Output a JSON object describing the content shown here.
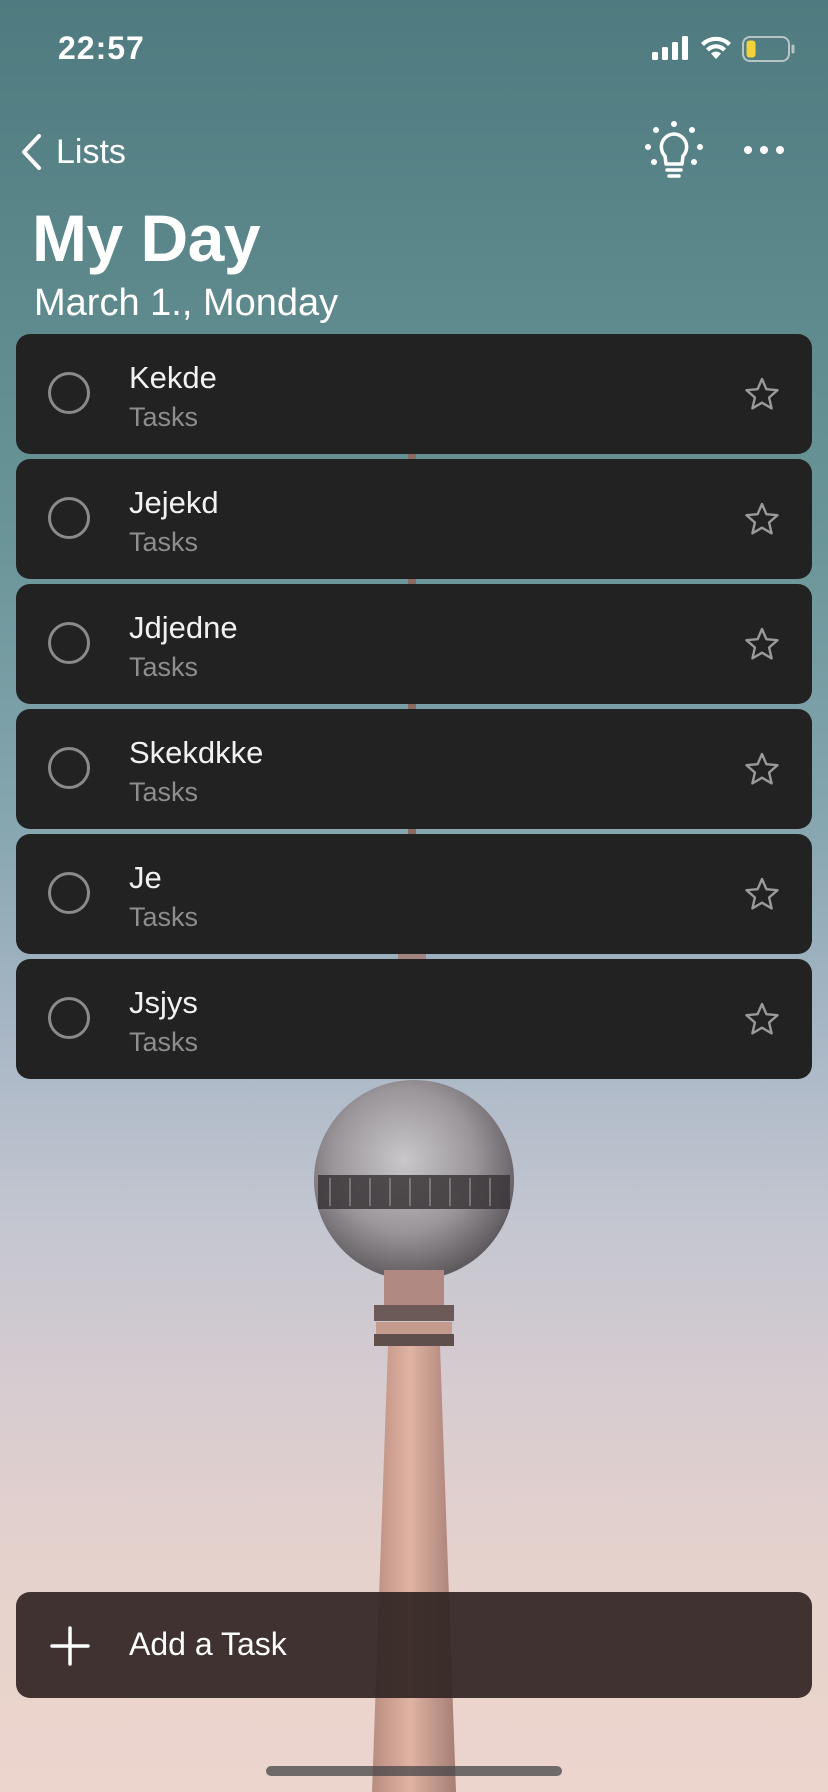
{
  "status_bar": {
    "time": "22:57",
    "battery_color": "#f2d23a"
  },
  "nav": {
    "back_label": "Lists",
    "icons": [
      "chevron-left-icon",
      "lightbulb-icon",
      "more-icon"
    ]
  },
  "header": {
    "title": "My Day",
    "date": "March 1., Monday"
  },
  "tasks": [
    {
      "title": "Kekde",
      "list": "Tasks"
    },
    {
      "title": "Jejekd",
      "list": "Tasks"
    },
    {
      "title": "Jdjedne",
      "list": "Tasks"
    },
    {
      "title": "Skekdkke",
      "list": "Tasks"
    },
    {
      "title": "Je",
      "list": "Tasks"
    },
    {
      "title": "Jsjys",
      "list": "Tasks"
    }
  ],
  "add_task": {
    "label": "Add a Task"
  },
  "colors": {
    "card": "#222222",
    "accent_text": "#ffffff",
    "muted_text": "#8e8e8e"
  }
}
